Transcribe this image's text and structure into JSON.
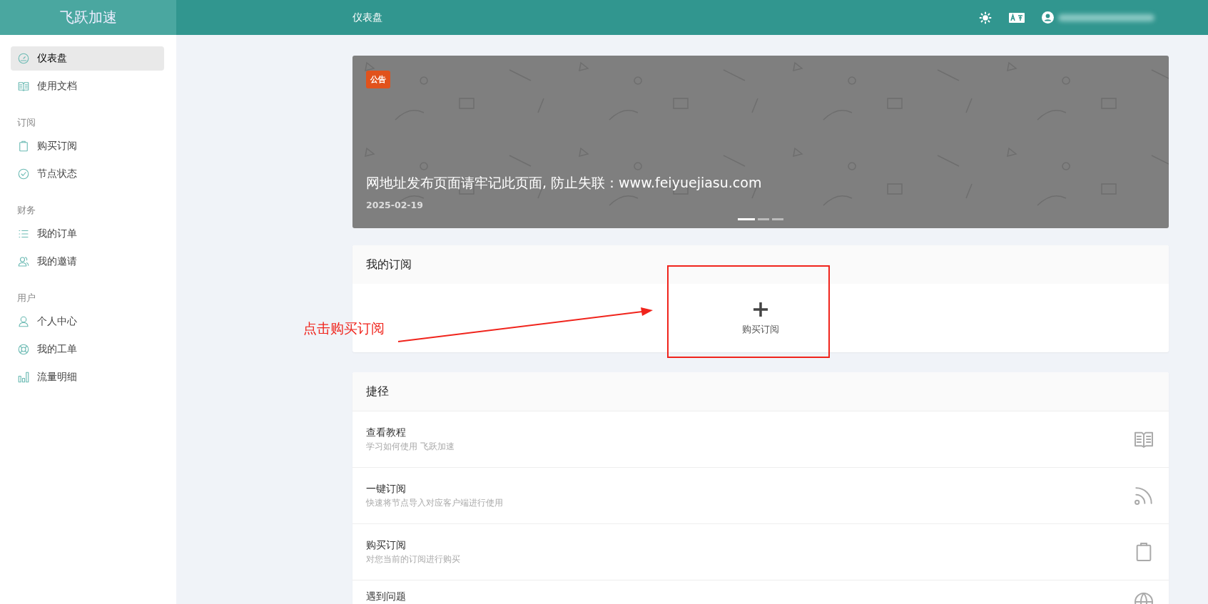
{
  "header": {
    "logo": "飞跃加速",
    "title": "仪表盘"
  },
  "sidebar": {
    "sections": [
      {
        "items": [
          {
            "label": "仪表盘",
            "selected": true
          },
          {
            "label": "使用文档",
            "selected": false
          }
        ]
      },
      {
        "heading": "订阅",
        "items": [
          {
            "label": "购买订阅",
            "selected": false
          },
          {
            "label": "节点状态",
            "selected": false
          }
        ]
      },
      {
        "heading": "财务",
        "items": [
          {
            "label": "我的订单",
            "selected": false
          },
          {
            "label": "我的邀请",
            "selected": false
          }
        ]
      },
      {
        "heading": "用户",
        "items": [
          {
            "label": "个人中心",
            "selected": false
          },
          {
            "label": "我的工单",
            "selected": false
          },
          {
            "label": "流量明细",
            "selected": false
          }
        ]
      }
    ]
  },
  "banner": {
    "badge": "公告",
    "title": "网地址发布页面请牢记此页面, 防止失联：www.feiyuejiasu.com",
    "date": "2025-02-19",
    "indicators": [
      {
        "selected": true
      },
      {
        "selected": false
      },
      {
        "selected": false
      }
    ]
  },
  "subscription": {
    "title": "我的订阅",
    "add_label": "购买订阅"
  },
  "shortcuts": {
    "title": "捷径",
    "items": [
      {
        "title": "查看教程",
        "subtitle": "学习如何使用 飞跃加速"
      },
      {
        "title": "一键订阅",
        "subtitle": "快速将节点导入对应客户端进行使用"
      },
      {
        "title": "购买订阅",
        "subtitle": "对您当前的订阅进行购买"
      },
      {
        "title": "遇到问题"
      }
    ]
  },
  "annotation": {
    "text": "点击购买订阅"
  }
}
